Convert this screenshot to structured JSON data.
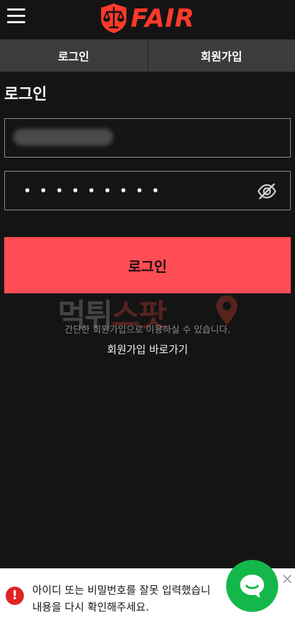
{
  "header": {
    "logo_text": "FAIR",
    "brand_color": "#ff3a2a",
    "menu_icon": "hamburger-menu-icon"
  },
  "tabs": [
    {
      "label": "로그인"
    },
    {
      "label": "회원가입"
    }
  ],
  "login": {
    "title": "로그인",
    "password_mask": "•••••••••",
    "password_toggle_icon": "eye-off-icon",
    "button_label": "로그인",
    "button_color": "#ff4d55"
  },
  "watermark": {
    "part1": "먹튀",
    "part2": "스팟"
  },
  "helper_text": "간단한 회원가입으로 이용하실 수 있습니다.",
  "signup_link": "회원가입 바로가기",
  "toast": {
    "line1": "아이디 또는 비밀번호를 잘못 입력했습니",
    "line2": "내용을 다시 확인해주세요.",
    "icon": "alert-icon",
    "alert_color": "#e02424"
  },
  "chat": {
    "icon": "chat-bubble-icon",
    "color": "#14b84a"
  }
}
